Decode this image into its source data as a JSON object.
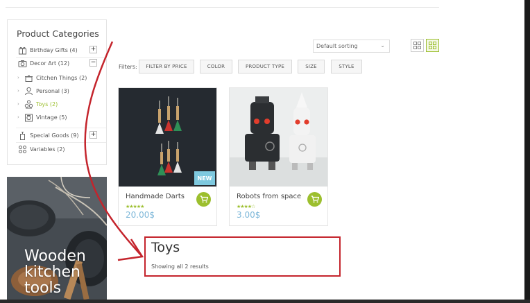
{
  "sidebar": {
    "title": "Product Categories",
    "categories": [
      {
        "label": "Birthday Gifts (4)",
        "toggle": "+"
      },
      {
        "label": "Decor Art (12)",
        "toggle": "−"
      },
      {
        "label": "Citchen Things (2)"
      },
      {
        "label": "Personal (3)"
      },
      {
        "label": "Toys (2)"
      },
      {
        "label": "Vintage (5)"
      },
      {
        "label": "Special Goods (9)",
        "toggle": "+"
      },
      {
        "label": "Variables (2)"
      }
    ]
  },
  "banner": {
    "line1": "Wooden",
    "line2": "kitchen",
    "line3": "tools"
  },
  "toolbar": {
    "sort_value": "Default sorting",
    "filters_label": "Filters:",
    "filters": [
      "FILTER BY PRICE",
      "COLOR",
      "PRODUCT TYPE",
      "SIZE",
      "STYLE"
    ]
  },
  "products": [
    {
      "name": "Handmade Darts",
      "price": "20.00$",
      "badge": "NEW",
      "rating": "★★★★★",
      "rating_value": 5
    },
    {
      "name": "Robots from space",
      "price": "3.00$",
      "rating": "★★★★☆",
      "rating_value": 4
    }
  ],
  "category_header": {
    "title": "Toys",
    "result_count": "Showing all 2 results"
  },
  "colors": {
    "accent": "#9cbf2e",
    "price": "#7fb8d9",
    "badge": "#7ec9df",
    "annotation": "#c4242c"
  }
}
